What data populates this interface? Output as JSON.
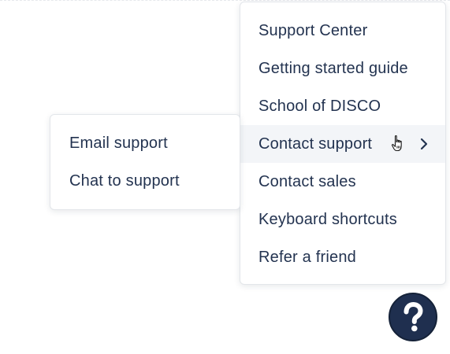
{
  "help_menu": {
    "items": [
      {
        "label": "Support Center"
      },
      {
        "label": "Getting started guide"
      },
      {
        "label": "School of DISCO"
      },
      {
        "label": "Contact support"
      },
      {
        "label": "Contact sales"
      },
      {
        "label": "Keyboard shortcuts"
      },
      {
        "label": "Refer a friend"
      }
    ],
    "active_index": 3
  },
  "contact_submenu": {
    "items": [
      {
        "label": "Email support"
      },
      {
        "label": "Chat to support"
      }
    ]
  },
  "help_button": {
    "icon": "question-mark-icon",
    "glyph": "?"
  },
  "colors": {
    "text": "#233350",
    "active_bg": "#f3f5f8",
    "help_button_bg": "#1f2f4f",
    "border": "#e3e6ea"
  }
}
